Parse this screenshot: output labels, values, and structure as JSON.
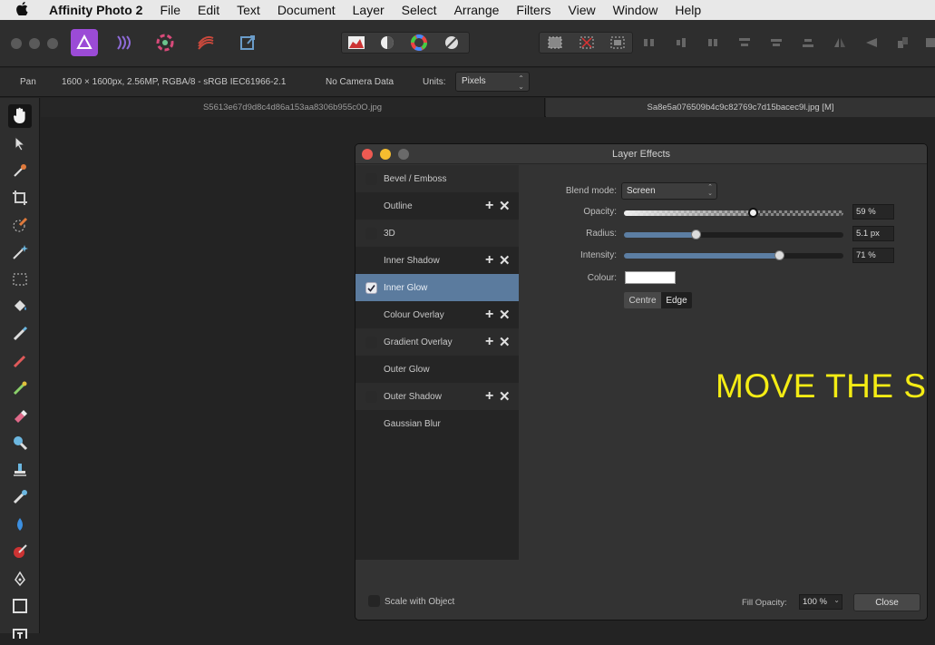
{
  "menubar": {
    "apple": "",
    "app_name": "Affinity Photo 2",
    "items": [
      "File",
      "Edit",
      "Text",
      "Document",
      "Layer",
      "Select",
      "Arrange",
      "Filters",
      "View",
      "Window",
      "Help"
    ]
  },
  "context": {
    "tool": "Pan",
    "doc_info": "1600 × 1600px, 2.56MP, RGBA/8 - sRGB IEC61966-2.1",
    "camera": "No Camera Data",
    "units_label": "Units:",
    "units_value": "Pixels"
  },
  "tabs": [
    {
      "label": "S5613e67d9d8c4d86a153aa8306b955c0O.jpg",
      "active": false
    },
    {
      "label": "Sa8e5a076509b4c9c82769c7d15bacec9l.jpg [M]",
      "active": true
    }
  ],
  "dialog": {
    "title": "Layer Effects",
    "effects": [
      {
        "label": "Bevel / Emboss",
        "checked": false,
        "has_actions": false
      },
      {
        "label": "Outline",
        "checked": false,
        "has_actions": true
      },
      {
        "label": "3D",
        "checked": false,
        "has_actions": false
      },
      {
        "label": "Inner Shadow",
        "checked": false,
        "has_actions": true
      },
      {
        "label": "Inner Glow",
        "checked": true,
        "has_actions": false,
        "selected": true
      },
      {
        "label": "Colour Overlay",
        "checked": false,
        "has_actions": true
      },
      {
        "label": "Gradient Overlay",
        "checked": false,
        "has_actions": true
      },
      {
        "label": "Outer Glow",
        "checked": false,
        "has_actions": false
      },
      {
        "label": "Outer Shadow",
        "checked": false,
        "has_actions": true
      },
      {
        "label": "Gaussian Blur",
        "checked": false,
        "has_actions": false
      }
    ],
    "action_add": "+",
    "action_remove": "✕",
    "move_up": "∧",
    "move_down": "∨",
    "props": {
      "blend_label": "Blend mode:",
      "blend_value": "Screen",
      "opacity_label": "Opacity:",
      "opacity_value": "59 %",
      "opacity_level": 0.59,
      "radius_label": "Radius:",
      "radius_value": "5.1 px",
      "radius_level": 0.33,
      "intensity_label": "Intensity:",
      "intensity_value": "71 %",
      "intensity_level": 0.71,
      "colour_label": "Colour:",
      "colour_value": "#ffffff",
      "centre_label": "Centre",
      "edge_label": "Edge"
    },
    "overlay_text": "MOVE THE SLIDERS",
    "scale_label": "Scale with Object",
    "fill_opacity_label": "Fill Opacity:",
    "fill_opacity_value": "100 %",
    "close_label": "Close"
  },
  "colors": {
    "accent": "#5b7b9e",
    "overlay_text": "#f4ec14"
  }
}
